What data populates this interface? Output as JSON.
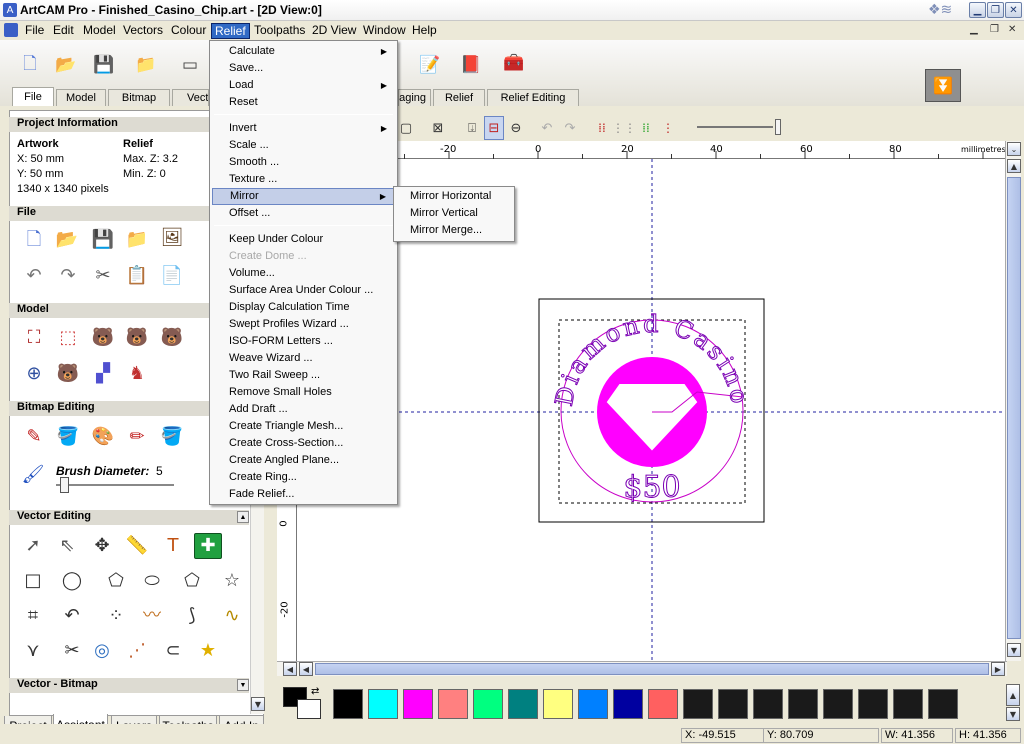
{
  "window": {
    "title": "ArtCAM Pro - Finished_Casino_Chip.art - [2D View:0]"
  },
  "menubar": [
    "File",
    "Edit",
    "Model",
    "Vectors",
    "Colour",
    "Relief",
    "Toolpaths",
    "2D View",
    "Window",
    "Help"
  ],
  "toolbar_tabs": [
    "File",
    "Model",
    "Bitmap",
    "Vector",
    "Imaging",
    "Relief",
    "Relief Editing"
  ],
  "panel": {
    "project_info": "Project Information",
    "artwork_label": "Artwork",
    "relief_label": "Relief",
    "art_x": "X: 50 mm",
    "art_y": "Y: 50 mm",
    "relief_max": "Max. Z: 3.2",
    "relief_min": "Min. Z: 0",
    "pixels": "1340 x 1340 pixels",
    "file": "File",
    "model": "Model",
    "bitmap_editing": "Bitmap Editing",
    "brush_label": "Brush Diameter:",
    "brush_value": "5",
    "vector_editing": "Vector Editing",
    "vector_bitmap": "Vector - Bitmap"
  },
  "bottom_tabs": [
    "Project",
    "Assistant",
    "Layers",
    "Toolpaths",
    "Add In"
  ],
  "ruler": {
    "units": "millimetres",
    "top_ticks": [
      "-20",
      "0",
      "20",
      "40",
      "60",
      "80"
    ],
    "left_ticks": [
      "0",
      "-20"
    ]
  },
  "chip": {
    "top_text": "Diamond Casino",
    "bottom_text": "$50"
  },
  "relief_menu": {
    "items": [
      {
        "label": "Calculate",
        "sub": true
      },
      {
        "label": "Save...",
        "sub": false
      },
      {
        "label": "Load",
        "sub": true
      },
      {
        "label": "Reset",
        "sub": false
      },
      {
        "label": "Invert",
        "sub": true
      },
      {
        "label": "Scale ...",
        "sub": false
      },
      {
        "label": "Smooth ...",
        "sub": false
      },
      {
        "label": "Texture ...",
        "sub": false
      },
      {
        "label": "Mirror",
        "sub": true,
        "highlight": true
      },
      {
        "label": "Offset ...",
        "sub": false
      },
      {
        "label": "Keep Under Colour",
        "sub": false
      },
      {
        "label": "Create Dome ...",
        "sub": false,
        "disabled": true
      },
      {
        "label": "Volume...",
        "sub": false
      },
      {
        "label": "Surface Area Under Colour ...",
        "sub": false
      },
      {
        "label": "Display Calculation Time",
        "sub": false
      },
      {
        "label": "Swept Profiles Wizard ...",
        "sub": false
      },
      {
        "label": "ISO-FORM Letters ...",
        "sub": false
      },
      {
        "label": "Weave Wizard ...",
        "sub": false
      },
      {
        "label": "Two Rail Sweep ...",
        "sub": false
      },
      {
        "label": "Remove Small Holes",
        "sub": false
      },
      {
        "label": "Add Draft ...",
        "sub": false
      },
      {
        "label": "Create Triangle Mesh...",
        "sub": false
      },
      {
        "label": "Create Cross-Section...",
        "sub": false
      },
      {
        "label": "Create Angled Plane...",
        "sub": false
      },
      {
        "label": "Create Ring...",
        "sub": false
      },
      {
        "label": "Fade Relief...",
        "sub": false
      }
    ]
  },
  "mirror_menu": [
    "Mirror Horizontal",
    "Mirror Vertical",
    "Mirror Merge..."
  ],
  "palette": [
    "#000000",
    "#ffffff",
    "#000000",
    "#00ffff",
    "#ff00ff",
    "#ff8080",
    "#00ff80",
    "#008080",
    "#ffff80",
    "#0080ff",
    "#0000a0",
    "#ff6060",
    "#1a1a1a",
    "#1a1a1a",
    "#1a1a1a",
    "#1a1a1a",
    "#1a1a1a",
    "#1a1a1a",
    "#1a1a1a",
    "#1a1a1a"
  ],
  "status": {
    "x": "X: -49.515",
    "y": "Y: 80.709",
    "w": "W: 41.356",
    "h": "H: 41.356"
  }
}
